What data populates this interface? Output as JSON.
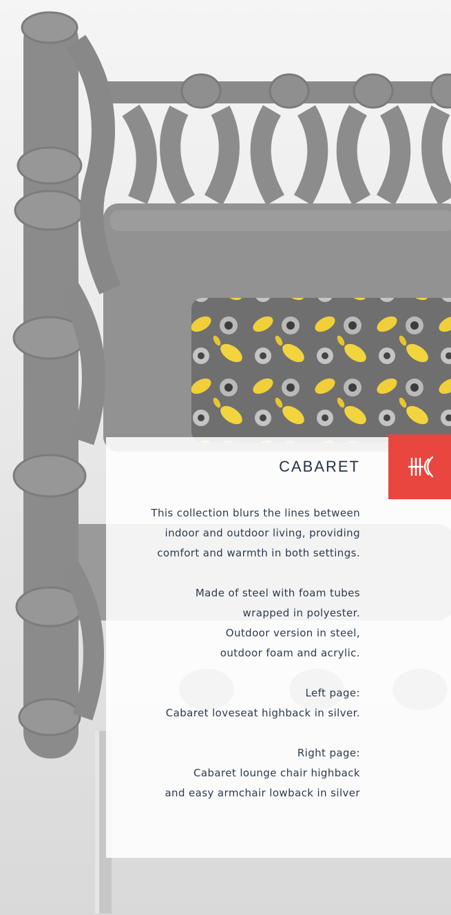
{
  "brand": {
    "accent": "#e8463f",
    "text_color": "#253344"
  },
  "collection": {
    "title": "CABARET",
    "intro": [
      "This collection blurs the lines between",
      "indoor and outdoor living, providing",
      "comfort and warmth in both settings."
    ],
    "materials": [
      "Made of steel with foam tubes",
      "wrapped in polyester.",
      "Outdoor version in steel,",
      "outdoor foam and acrylic."
    ],
    "left_page": [
      "Left page:",
      "Cabaret loveseat highback in silver."
    ],
    "right_page": [
      "Right page:",
      "Cabaret lounge chair highback",
      "and easy armchair lowback in silver"
    ]
  },
  "icons": {
    "logo": "brand-logo-icon"
  }
}
